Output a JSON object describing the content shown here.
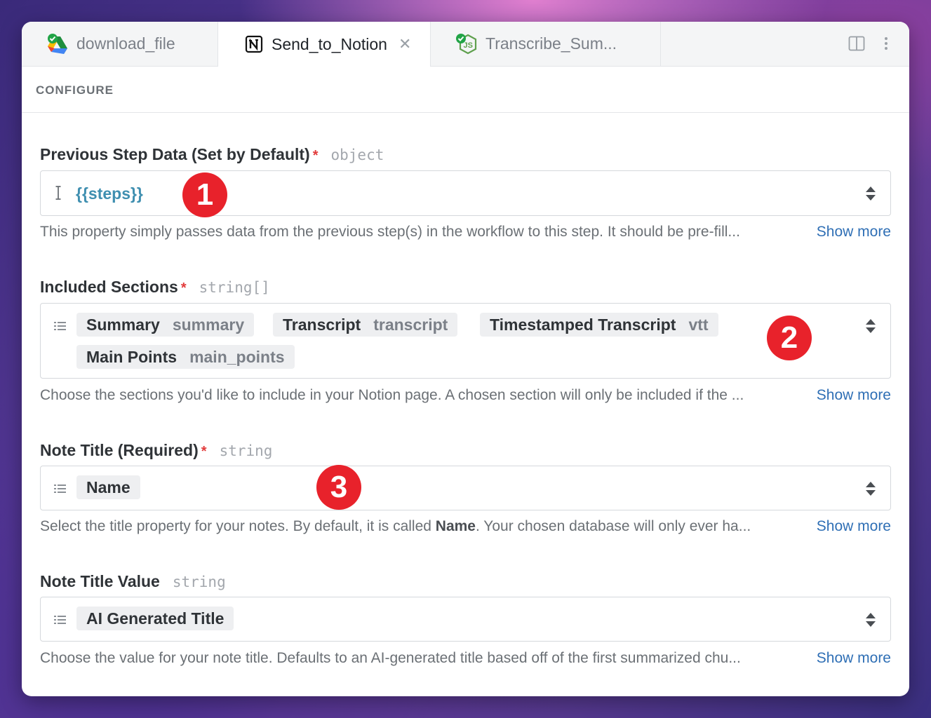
{
  "tabs": [
    {
      "label": "download_file",
      "icon": "google-drive-icon"
    },
    {
      "label": "Send_to_Notion",
      "icon": "notion-icon",
      "active": true
    },
    {
      "label": "Transcribe_Sum...",
      "icon": "nodejs-icon"
    }
  ],
  "section": {
    "title": "CONFIGURE"
  },
  "fields": [
    {
      "label": "Previous Step Data (Set by Default)",
      "required": "*",
      "type": "object",
      "value": "{{steps}}",
      "help": "This property simply passes data from the previous step(s) in the workflow to this step. It should be pre-fill...",
      "show_more": "Show more",
      "marker": "1"
    },
    {
      "label": "Included Sections",
      "required": "*",
      "type": "string[]",
      "chips": [
        {
          "label": "Summary",
          "value": "summary"
        },
        {
          "label": "Transcript",
          "value": "transcript"
        },
        {
          "label": "Timestamped Transcript",
          "value": "vtt"
        },
        {
          "label": "Main Points",
          "value": "main_points"
        }
      ],
      "help": "Choose the sections you'd like to include in your Notion page. A chosen section will only be included if the ...",
      "show_more": "Show more",
      "marker": "2"
    },
    {
      "label": "Note Title (Required)",
      "required": "*",
      "type": "string",
      "chip": "Name",
      "help_pre": "Select the title property for your notes. By default, it is called ",
      "help_bold": "Name",
      "help_post": ". Your chosen database will only ever ha...",
      "show_more": "Show more",
      "marker": "3"
    },
    {
      "label": "Note Title Value",
      "type": "string",
      "chip": "AI Generated Title",
      "help": "Choose the value for your note title. Defaults to an AI-generated title based off of the first summarized chu...",
      "show_more": "Show more"
    }
  ],
  "colors": {
    "accent_link": "#2f6fb5",
    "required": "#e23b3b",
    "marker": "#e8222b",
    "steps_value": "#3f8fb0"
  }
}
